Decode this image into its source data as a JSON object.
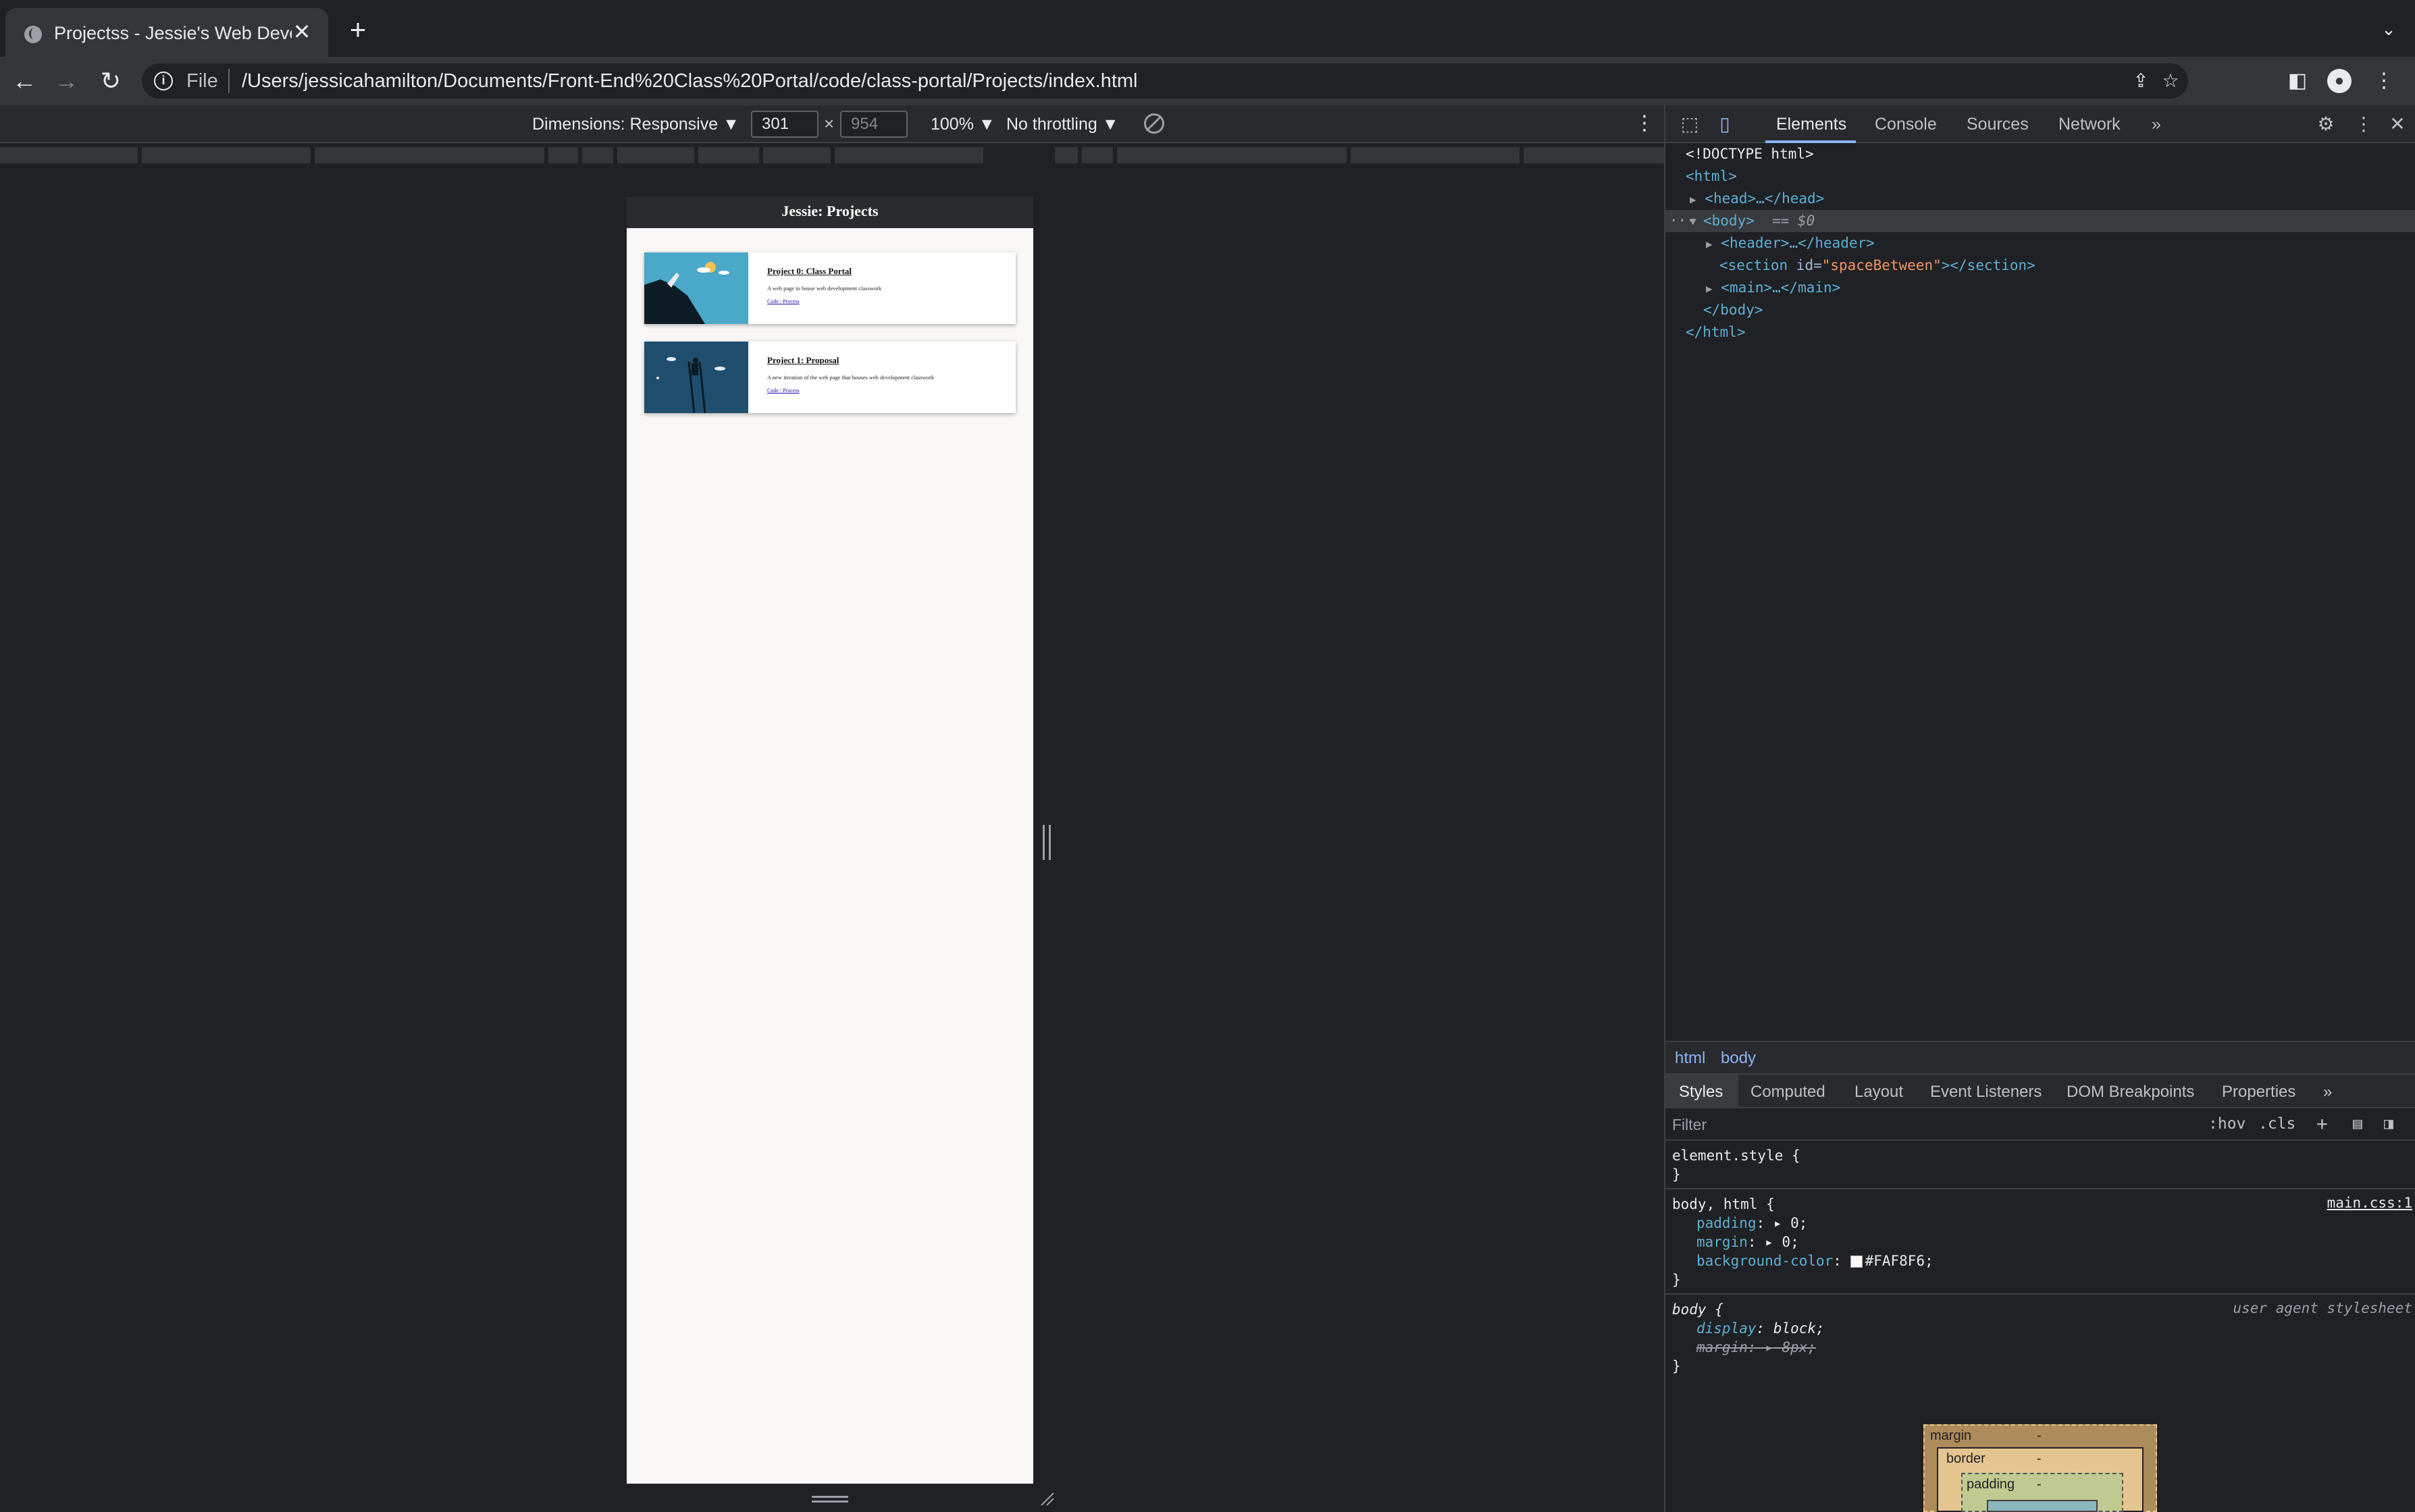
{
  "browser": {
    "tab_title": "Projectss - Jessie's Web Devel",
    "new_tab": "+",
    "close_tab": "✕",
    "url_scheme": "File",
    "url": "/Users/jessicahamilton/Documents/Front-End%20Class%20Portal/code/class-portal/Projects/index.html"
  },
  "device_toolbar": {
    "dimensions": "Dimensions: Responsive ▼",
    "width": "301",
    "height": "954",
    "times": "×",
    "zoom": "100% ▼",
    "throttling": "No throttling ▼"
  },
  "page": {
    "header_title": "Jessie: Projects",
    "cards": [
      {
        "title": "Project 0: Class Portal",
        "description": "A web page to house web development classwork",
        "links": "Code / Process"
      },
      {
        "title": "Project 1: Proposal",
        "description": "A new iteration of the web page that houses web development classwork",
        "links": "Code / Process"
      }
    ]
  },
  "devtools": {
    "tabs": [
      "Elements",
      "Console",
      "Sources",
      "Network"
    ],
    "more": "»",
    "dom": {
      "doctype": "<!DOCTYPE html>",
      "html_open": "<html>",
      "head": "<head>…</head>",
      "body_open": "<body>",
      "body_marker": "== $0",
      "header": "<header>…</header>",
      "section_open": "<section ",
      "section_attr": "id=",
      "section_val": "\"spaceBetween\"",
      "section_close": "></section>",
      "main": "<main>…</main>",
      "body_close": "</body>",
      "html_close": "</html>",
      "dots": "···"
    },
    "breadcrumbs": [
      "html",
      "body"
    ],
    "style_tabs": [
      "Styles",
      "Computed",
      "Layout",
      "Event Listeners",
      "DOM Breakpoints",
      "Properties"
    ],
    "filter_placeholder": "Filter",
    "hov": ":hov",
    "cls": ".cls",
    "styles": {
      "element_style": "element.style {",
      "close": "}",
      "rule1_selector": "body, html {",
      "rule1_source": "main.css:1",
      "rule1_props": [
        {
          "name": "padding",
          "value": "▸ 0;"
        },
        {
          "name": "margin",
          "value": "▸ 0;"
        },
        {
          "name": "background-color",
          "value": "#FAF8F6;"
        }
      ],
      "rule2_selector": "body {",
      "rule2_source": "user agent stylesheet",
      "rule2_props": [
        {
          "name": "display",
          "value": "block;"
        },
        {
          "name": "margin",
          "value": "▸ 8px;"
        }
      ]
    },
    "boxmodel": {
      "margin": "margin",
      "border": "border",
      "padding": "padding",
      "dash": "-"
    }
  },
  "colors": {
    "body_bg": "#FAF8F6",
    "accent": "#8ab4f8"
  }
}
